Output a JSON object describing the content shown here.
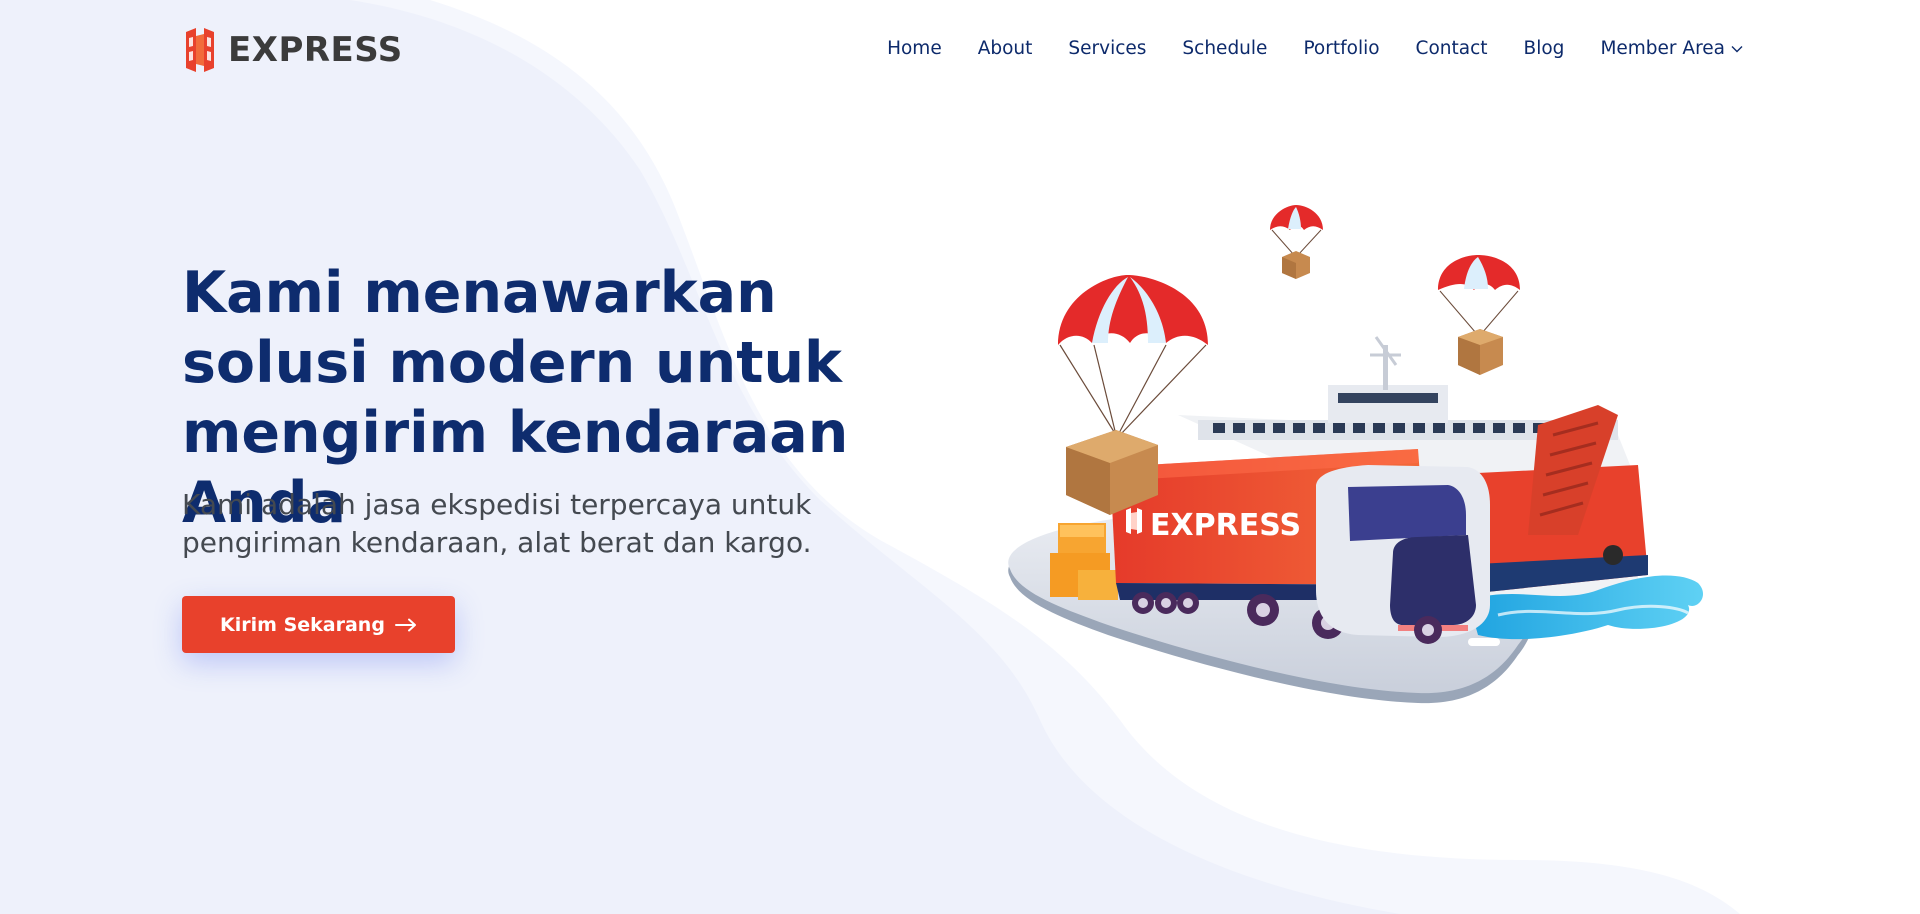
{
  "brand": {
    "name": "EXPRESS",
    "accent_color": "#e8412c",
    "navy_color": "#0e2c6e"
  },
  "nav": {
    "items": [
      {
        "label": "Home"
      },
      {
        "label": "About"
      },
      {
        "label": "Services"
      },
      {
        "label": "Schedule"
      },
      {
        "label": "Portfolio"
      },
      {
        "label": "Contact"
      },
      {
        "label": "Blog"
      }
    ],
    "member_area": {
      "label": "Member Area",
      "icon": "chevron-down-icon"
    }
  },
  "hero": {
    "title": "Kami menawarkan solusi modern untuk mengirim kendaraan Anda",
    "subtitle": "Kami adalah jasa ekspedisi terpercaya untuk pengiriman kendaraan, alat berat dan kargo.",
    "cta_label": "Kirim Sekarang",
    "cta_icon": "arrow-right-icon"
  },
  "illustration": {
    "truck_text": "EXPRESS",
    "description_icon": "logistics-illustration"
  }
}
